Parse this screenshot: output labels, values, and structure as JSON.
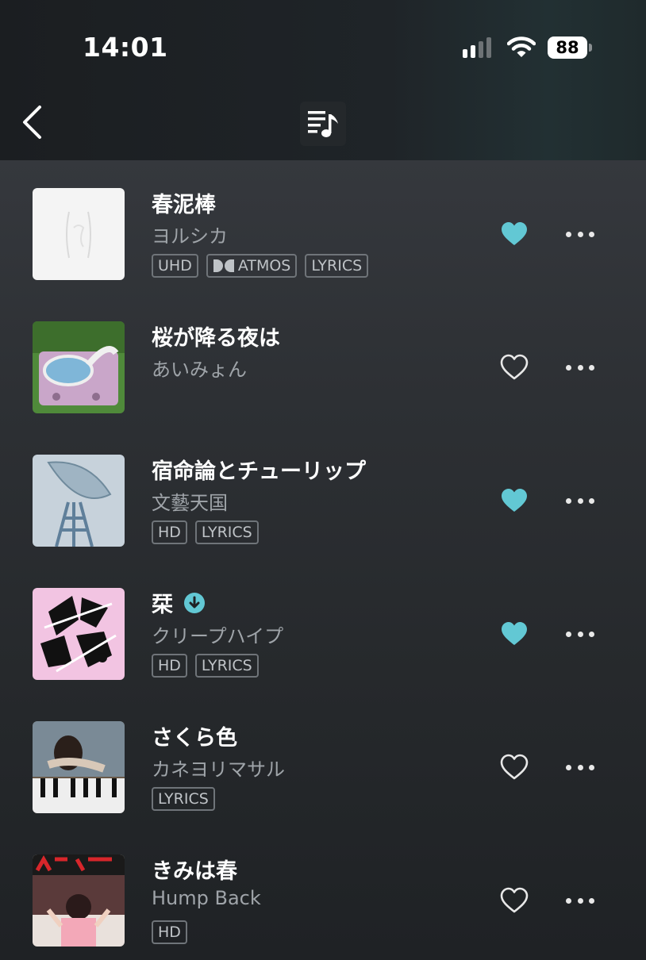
{
  "status_bar": {
    "time": "14:01",
    "battery": "88"
  },
  "colors": {
    "accent": "#62c8d4",
    "badge_border": "#6f7479",
    "secondary_text": "#9fa4a9"
  },
  "nav": {
    "back_icon": "chevron-left-icon",
    "queue_icon": "playlist-music-icon"
  },
  "tracks": [
    {
      "title": "春泥棒",
      "artist": "ヨルシカ",
      "badges": [
        "UHD",
        "ATMOS",
        "LYRICS"
      ],
      "liked": true,
      "downloaded": false
    },
    {
      "title": "桜が降る夜は",
      "artist": "あいみょん",
      "badges": [],
      "liked": false,
      "downloaded": false
    },
    {
      "title": "宿命論とチューリップ",
      "artist": "文藝天国",
      "badges": [
        "HD",
        "LYRICS"
      ],
      "liked": true,
      "downloaded": false
    },
    {
      "title": "栞",
      "artist": "クリープハイプ",
      "badges": [
        "HD",
        "LYRICS"
      ],
      "liked": true,
      "downloaded": true
    },
    {
      "title": "さくら色",
      "artist": "カネヨリマサル",
      "badges": [
        "LYRICS"
      ],
      "liked": false,
      "downloaded": false
    },
    {
      "title": "きみは春",
      "artist": "Hump Back",
      "badges": [
        "HD"
      ],
      "liked": false,
      "downloaded": false
    }
  ]
}
